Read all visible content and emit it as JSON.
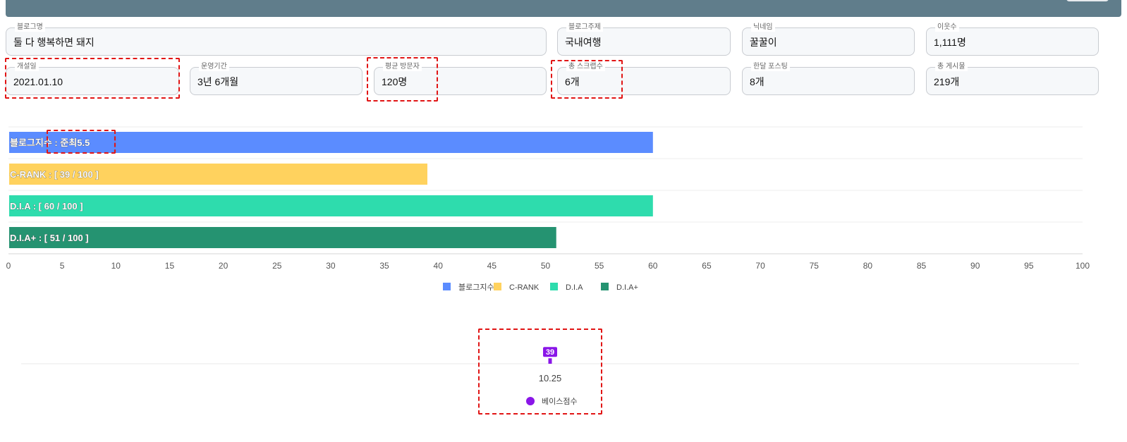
{
  "fields": {
    "blog_name": {
      "label": "블로그명",
      "value": "둘 다 행복하면 돼지"
    },
    "blog_topic": {
      "label": "블로그주제",
      "value": "국내여행"
    },
    "nickname": {
      "label": "닉네임",
      "value": "꿀꿀이"
    },
    "neighbors": {
      "label": "이웃수",
      "value": "1,111명"
    },
    "open_date": {
      "label": "개설일",
      "value": "2021.01.10"
    },
    "period": {
      "label": "운영기간",
      "value": "3년 6개월"
    },
    "avg_visitors": {
      "label": "평균 방문자",
      "value": "120명"
    },
    "scraps": {
      "label": "총 스크랩수",
      "value": "6개"
    },
    "monthly_posts": {
      "label": "한달 포스팅",
      "value": "8개"
    },
    "total_posts": {
      "label": "총 게시물",
      "value": "219개"
    }
  },
  "chart_data": [
    {
      "type": "bar",
      "orientation": "horizontal",
      "categories": [
        "블로그지수",
        "C-RANK",
        "D.I.A",
        "D.I.A+"
      ],
      "values": [
        60,
        39,
        60,
        51
      ],
      "bar_labels": [
        "블로그지수 : 준최5.5",
        "C-RANK : [ 39 / 100 ]",
        "D.I.A : [ 60 / 100 ]",
        "D.I.A+ : [ 51 / 100 ]"
      ],
      "colors": [
        "#5b8cff",
        "#ffd25e",
        "#2edcad",
        "#259371"
      ],
      "xlim": [
        0,
        100
      ],
      "xticks": [
        0,
        5,
        10,
        15,
        20,
        25,
        30,
        35,
        40,
        45,
        50,
        55,
        60,
        65,
        70,
        75,
        80,
        85,
        90,
        95,
        100
      ],
      "grid": true,
      "legend": "bottom-center",
      "legend_labels": [
        "블로그지수",
        "C-RANK",
        "D.I.A",
        "D.I.A+"
      ]
    },
    {
      "type": "bar",
      "categories": [
        "10.25"
      ],
      "series": [
        {
          "name": "베이스점수",
          "values": [
            39
          ],
          "color": "#8a16e8"
        }
      ],
      "data_labels": [
        "39"
      ],
      "legend": "bottom-center"
    }
  ]
}
